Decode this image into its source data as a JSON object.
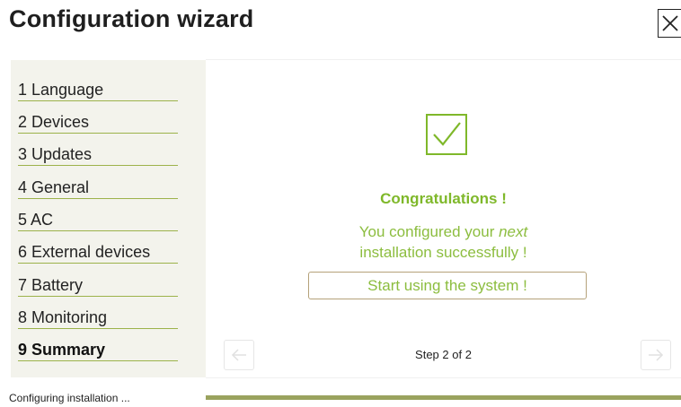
{
  "wizard": {
    "title": "Configuration wizard",
    "close_icon": "close-icon"
  },
  "steps": [
    {
      "label": "1 Language",
      "active": false
    },
    {
      "label": "2 Devices",
      "active": false
    },
    {
      "label": "3 Updates",
      "active": false
    },
    {
      "label": "4 General",
      "active": false
    },
    {
      "label": "5 AC",
      "active": false
    },
    {
      "label": "6 External devices",
      "active": false
    },
    {
      "label": "7 Battery",
      "active": false
    },
    {
      "label": "8 Monitoring",
      "active": false
    },
    {
      "label": "9 Summary",
      "active": true
    }
  ],
  "summary": {
    "check_icon": "checkbox-check-icon",
    "congrats": "Congratulations !",
    "message_before": "You configured your ",
    "message_emphasis": "next",
    "message_after": "installation successfully !",
    "start_button": "Start using the system !"
  },
  "navigation": {
    "prev_icon": "arrow-left-icon",
    "next_icon": "arrow-right-icon",
    "step_counter": "Step 2 of 2"
  },
  "footer": {
    "status": "Configuring installation ...",
    "progress": 1.0
  },
  "colors": {
    "accent_green": "#7fb82a",
    "divider_green": "#9cb24a",
    "progress": "#9aa35e",
    "sidebar_bg": "#f3f3ec"
  }
}
